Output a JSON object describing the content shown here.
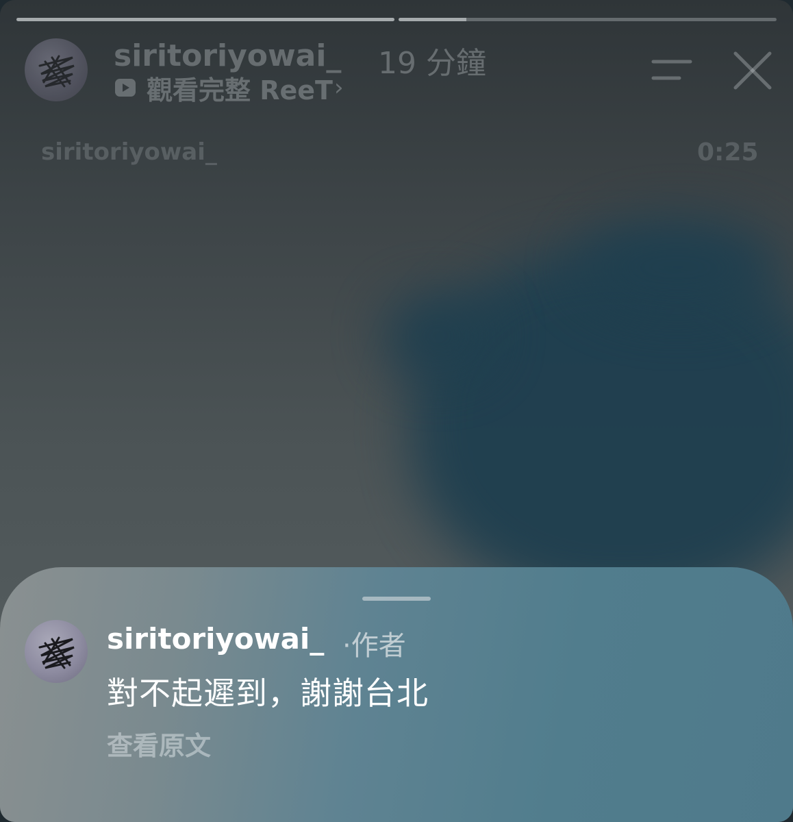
{
  "story": {
    "progress": [
      1.0,
      0.18
    ]
  },
  "header": {
    "username": "siritoriyowai_",
    "time_ago": "19 分鐘",
    "reel_link_label": "觀看完整 ReeT",
    "reel_link_chevron": "›",
    "icons": [
      "avatar",
      "menu-icon",
      "close-icon",
      "play-icon"
    ]
  },
  "video": {
    "username": "siritoriyowai_",
    "duration": "0:25"
  },
  "comment_sheet": {
    "author": "siritoriyowai_",
    "author_badge": "·作者",
    "text": "對不起遲到，謝謝台北",
    "see_original_label": "查看原文"
  }
}
